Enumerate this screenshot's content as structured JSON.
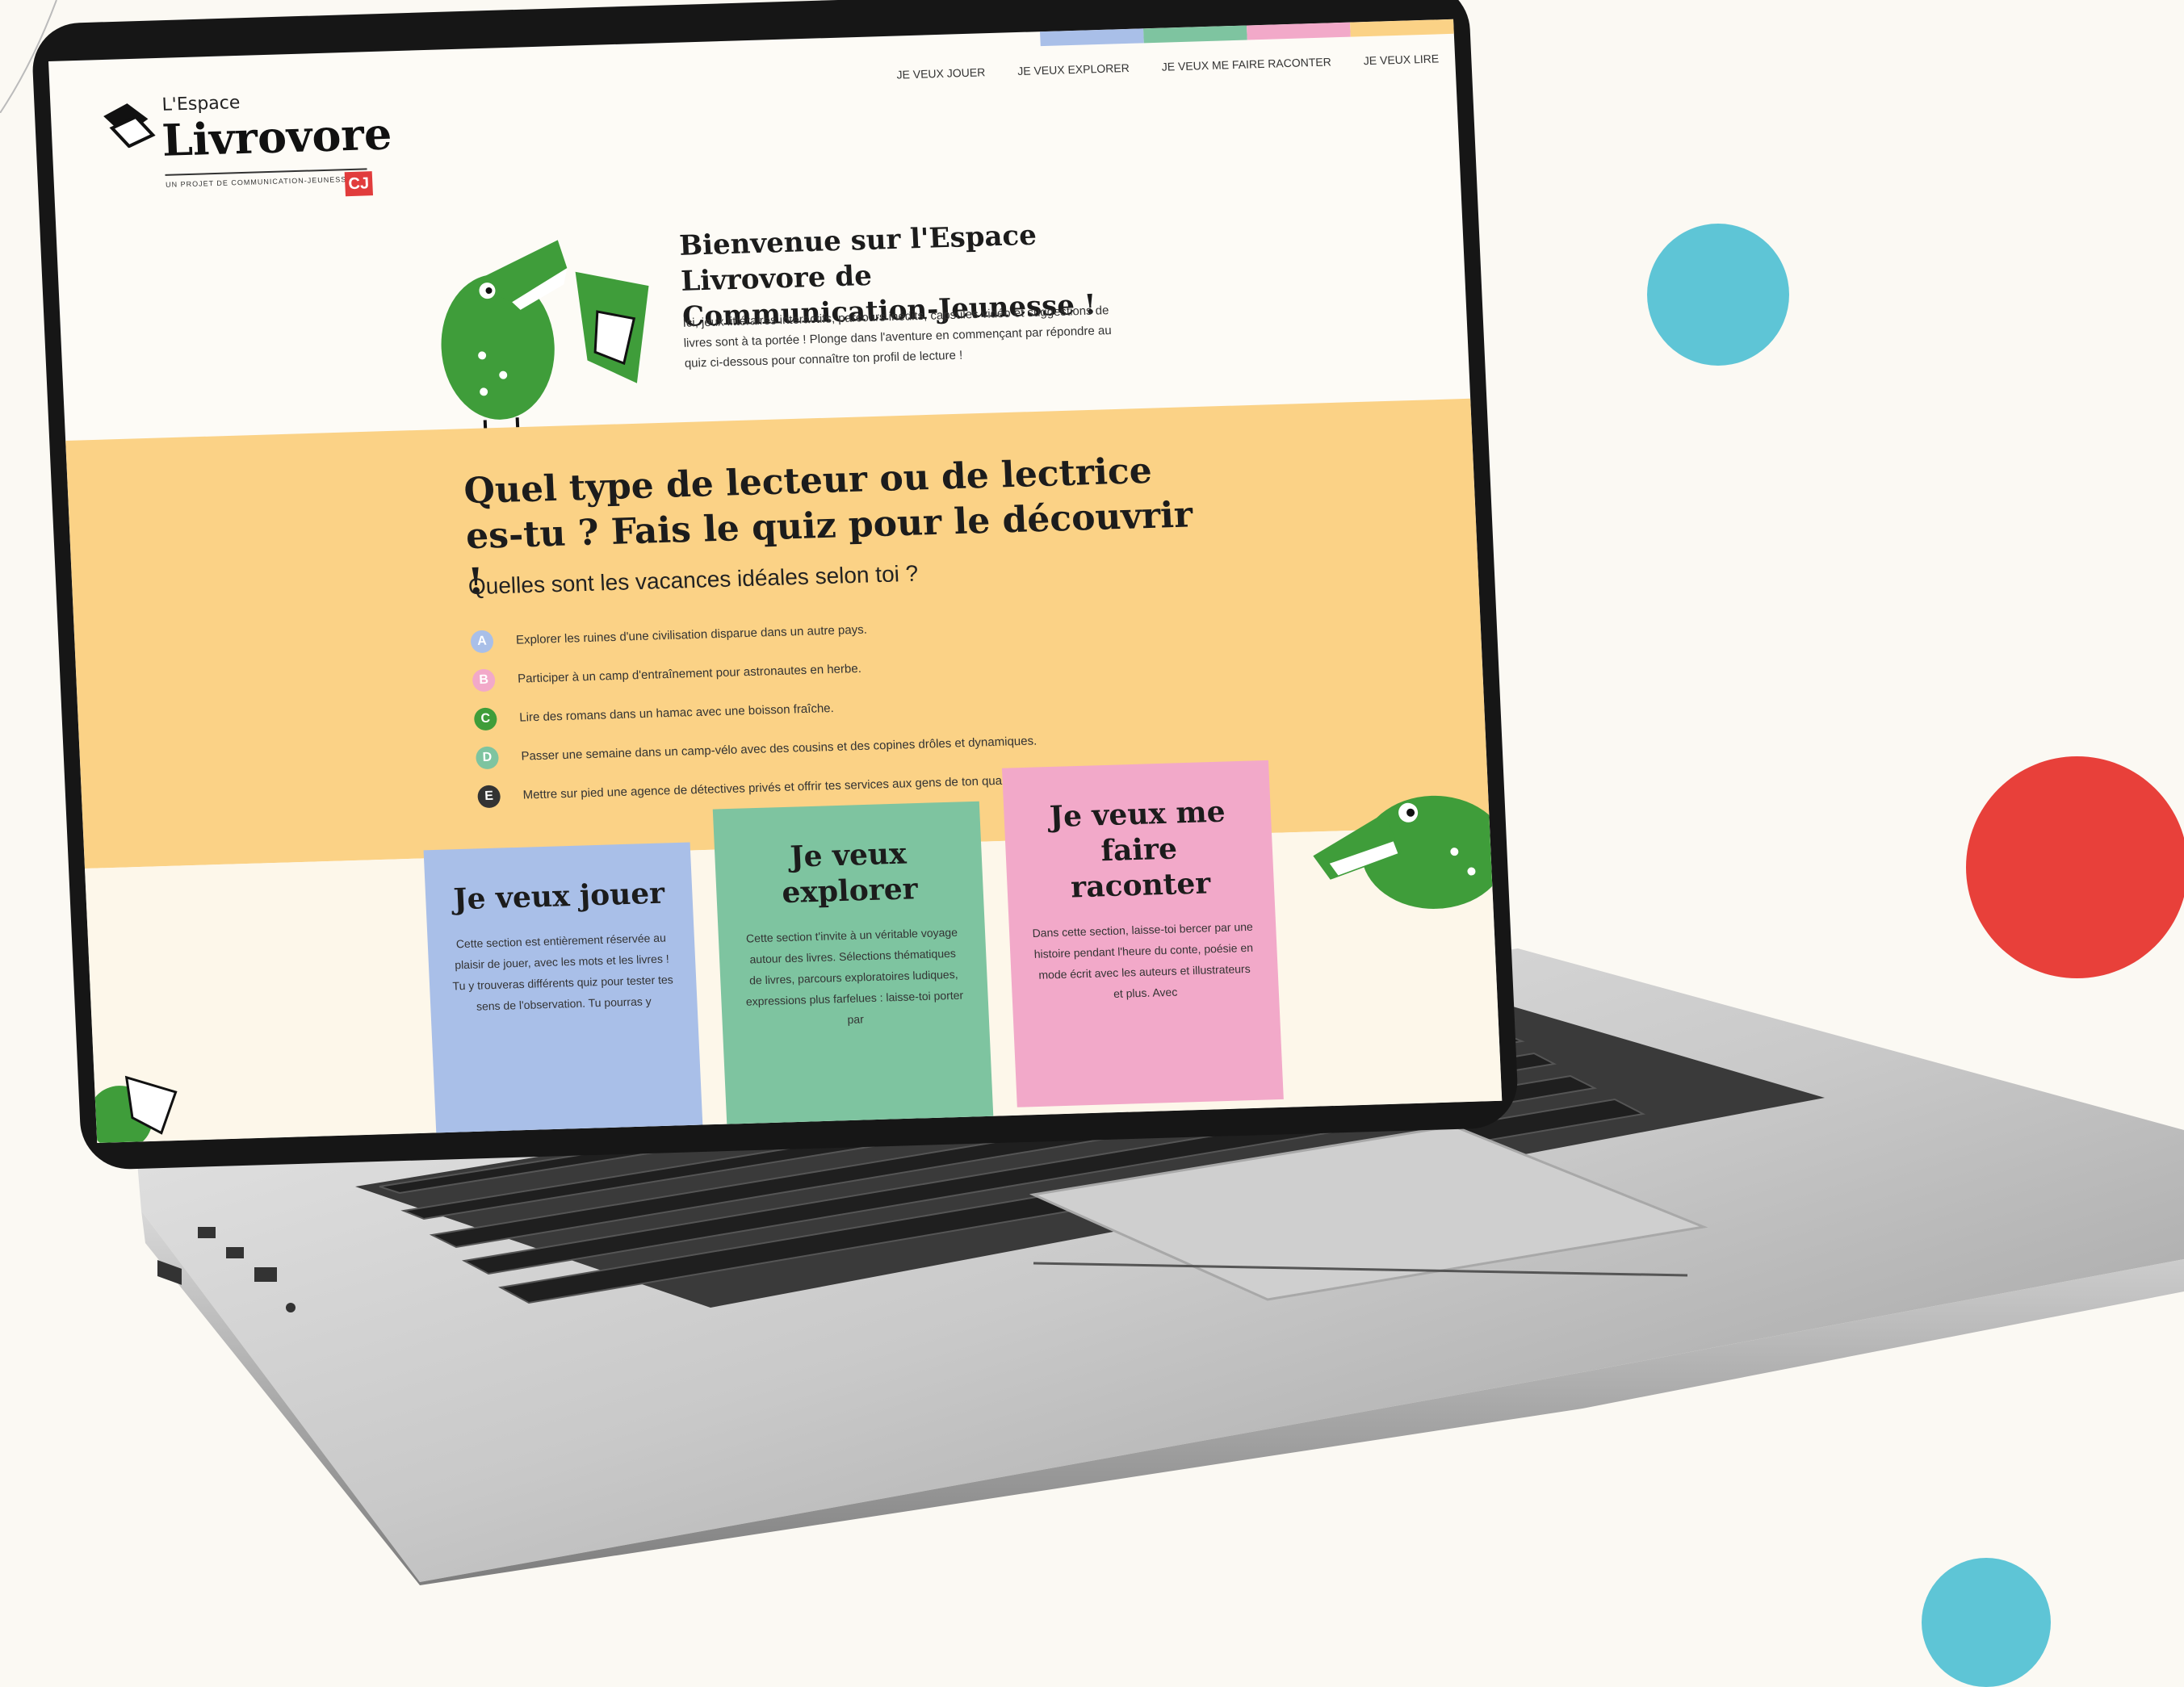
{
  "colors": {
    "background": "#fbf9f3",
    "dot_blue": "#5ec5d6",
    "dot_red": "#e8403a",
    "quiz_band": "#fbd286",
    "card_blue": "#a9bfe8",
    "card_green": "#7ec4a0",
    "card_pink": "#f2a9c9",
    "croc_green": "#3f9d3a",
    "strip": [
      "#a9bfe8",
      "#7ec4a0",
      "#f2a9c9",
      "#fbd286"
    ]
  },
  "logo": {
    "small": "L'Espace",
    "big": "Livrovore",
    "tagline": "UN PROJET DE COMMUNICATION-JEUNESSE",
    "badge": "CJ"
  },
  "nav": {
    "items": [
      {
        "label": "Je veux jouer"
      },
      {
        "label": "Je veux explorer"
      },
      {
        "label": "Je veux me faire raconter"
      },
      {
        "label": "Je veux lire"
      }
    ]
  },
  "welcome": {
    "title": "Bienvenue sur l'Espace Livrovore de Communication-Jeunesse !",
    "text": "Ici, jeux littéraires interactifs, parcours inédits, capsules vidéo et suggestions de livres sont à ta portée ! Plonge dans l'aventure en commençant par répondre au quiz ci-dessous pour connaître ton profil de lecture !"
  },
  "quiz": {
    "title": "Quel type de lecteur ou de lectrice es-tu ? Fais le quiz pour le découvrir !",
    "question": "Quelles sont les vacances idéales selon toi ?",
    "answers": [
      {
        "letter": "A",
        "color": "#a9bfe8",
        "text": "Explorer les ruines d'une civilisation disparue dans un autre pays."
      },
      {
        "letter": "B",
        "color": "#f2a9c9",
        "text": "Participer à un camp d'entraînement pour astronautes en herbe."
      },
      {
        "letter": "C",
        "color": "#3f9d3a",
        "text": "Lire des romans dans un hamac avec une boisson fraîche."
      },
      {
        "letter": "D",
        "color": "#7ec4a0",
        "text": "Passer une semaine dans un camp-vélo avec des cousins et des copines drôles et dynamiques."
      },
      {
        "letter": "E",
        "color": "#333333",
        "text": "Mettre sur pied une agence de détectives privés et offrir tes services aux gens de ton quartier."
      }
    ]
  },
  "cards": [
    {
      "title": "Je veux jouer",
      "color": "#a9bfe8",
      "text": "Cette section est entièrement réservée au plaisir de jouer, avec les mots et les livres ! Tu y trouveras différents quiz pour tester tes sens de l'observation. Tu pourras y"
    },
    {
      "title": "Je veux explorer",
      "color": "#7ec4a0",
      "text": "Cette section t'invite à un véritable voyage autour des livres. Sélections thématiques de livres, parcours exploratoires ludiques, expressions plus farfelues : laisse-toi porter par"
    },
    {
      "title": "Je veux me faire raconter",
      "color": "#f2a9c9",
      "text": "Dans cette section, laisse-toi bercer par une histoire pendant l'heure du conte, poésie en mode écrit avec les auteurs et illustrateurs et plus. Avec"
    }
  ]
}
